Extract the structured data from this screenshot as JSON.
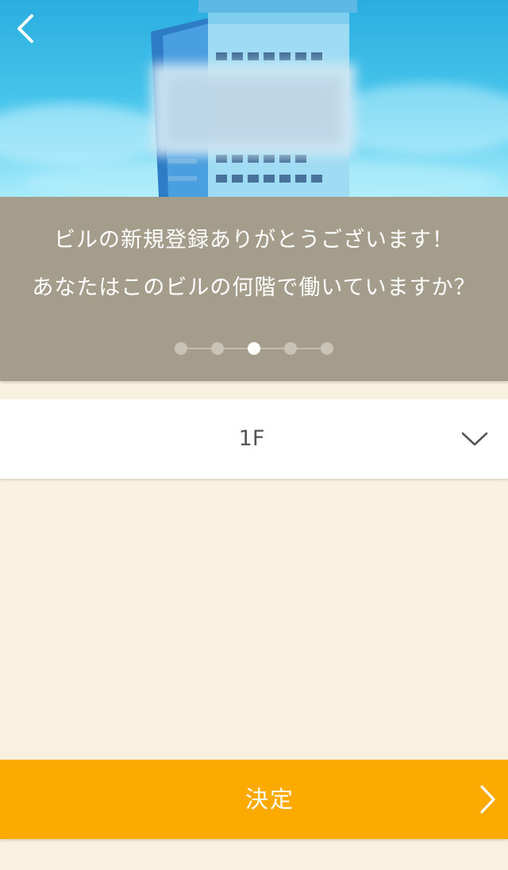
{
  "header": {
    "back_icon": "chevron-left-icon",
    "image": "building-illustration"
  },
  "message": {
    "line1": "ビルの新規登録ありがとうございます！",
    "line2": "あなたはこのビルの何階で働いていますか？"
  },
  "progress": {
    "total_steps": 5,
    "current_step": 3
  },
  "floor_select": {
    "value": "1F",
    "icon": "chevron-down-icon"
  },
  "submit": {
    "label": "決定",
    "icon": "chevron-right-icon"
  },
  "colors": {
    "panel": "#a59d8b",
    "page_background": "#f8f1e0",
    "accent": "#fdaa00"
  }
}
